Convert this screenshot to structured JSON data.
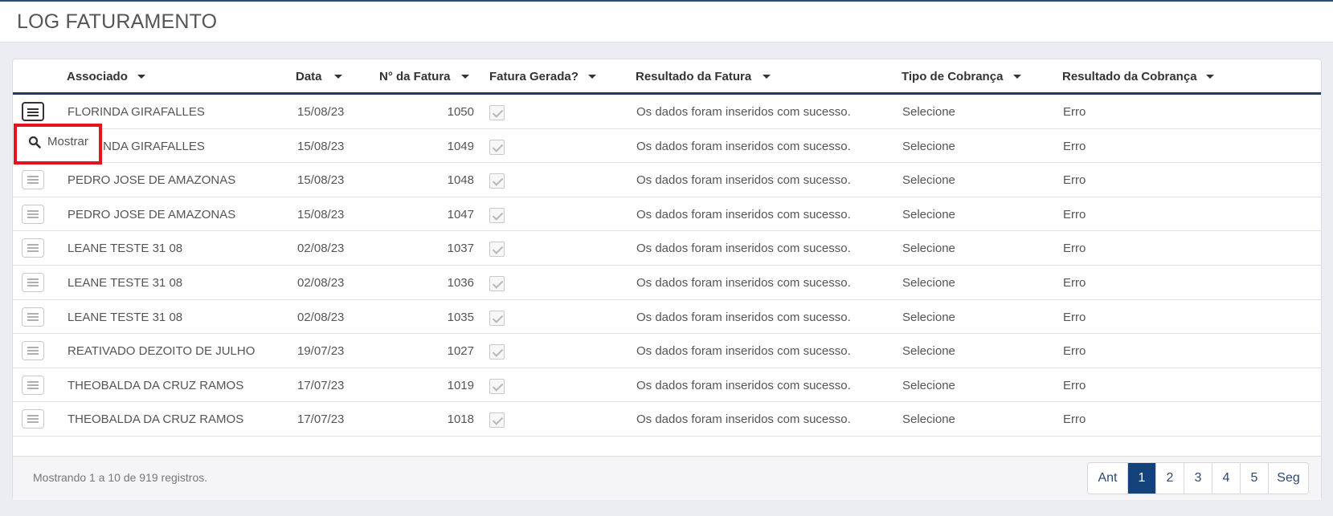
{
  "header": {
    "title": "LOG FATURAMENTO"
  },
  "table": {
    "columns": [
      "Associado",
      "Data",
      "N° da Fatura",
      "Fatura Gerada?",
      "Resultado da Fatura",
      "Tipo de Cobrança",
      "Resultado da Cobrança"
    ],
    "rows": [
      {
        "associado": "FLORINDA GIRAFALLES",
        "data": "15/08/23",
        "fatura": "1050",
        "resultado": "Os dados foram inseridos com sucesso.",
        "tipo": "Selecione",
        "resultado_cobranca": "Erro"
      },
      {
        "associado": "FLORINDA GIRAFALLES",
        "data": "15/08/23",
        "fatura": "1049",
        "resultado": "Os dados foram inseridos com sucesso.",
        "tipo": "Selecione",
        "resultado_cobranca": "Erro"
      },
      {
        "associado": "PEDRO JOSE DE AMAZONAS",
        "data": "15/08/23",
        "fatura": "1048",
        "resultado": "Os dados foram inseridos com sucesso.",
        "tipo": "Selecione",
        "resultado_cobranca": "Erro"
      },
      {
        "associado": "PEDRO JOSE DE AMAZONAS",
        "data": "15/08/23",
        "fatura": "1047",
        "resultado": "Os dados foram inseridos com sucesso.",
        "tipo": "Selecione",
        "resultado_cobranca": "Erro"
      },
      {
        "associado": "LEANE TESTE 31 08",
        "data": "02/08/23",
        "fatura": "1037",
        "resultado": "Os dados foram inseridos com sucesso.",
        "tipo": "Selecione",
        "resultado_cobranca": "Erro"
      },
      {
        "associado": "LEANE TESTE 31 08",
        "data": "02/08/23",
        "fatura": "1036",
        "resultado": "Os dados foram inseridos com sucesso.",
        "tipo": "Selecione",
        "resultado_cobranca": "Erro"
      },
      {
        "associado": "LEANE TESTE 31 08",
        "data": "02/08/23",
        "fatura": "1035",
        "resultado": "Os dados foram inseridos com sucesso.",
        "tipo": "Selecione",
        "resultado_cobranca": "Erro"
      },
      {
        "associado": "REATIVADO DEZOITO DE JULHO",
        "data": "19/07/23",
        "fatura": "1027",
        "resultado": "Os dados foram inseridos com sucesso.",
        "tipo": "Selecione",
        "resultado_cobranca": "Erro"
      },
      {
        "associado": "THEOBALDA DA CRUZ RAMOS",
        "data": "17/07/23",
        "fatura": "1019",
        "resultado": "Os dados foram inseridos com sucesso.",
        "tipo": "Selecione",
        "resultado_cobranca": "Erro"
      },
      {
        "associado": "THEOBALDA DA CRUZ RAMOS",
        "data": "17/07/23",
        "fatura": "1018",
        "resultado": "Os dados foram inseridos com sucesso.",
        "tipo": "Selecione",
        "resultado_cobranca": "Erro"
      }
    ]
  },
  "footer": {
    "info": "Mostrando 1 a 10 de 919 registros.",
    "pagination": [
      "Ant",
      "1",
      "2",
      "3",
      "4",
      "5",
      "Seg"
    ],
    "active_page": "1"
  },
  "popup": {
    "label": "Mostrar",
    "icon": "search-icon"
  },
  "colors": {
    "accent": "#14427a",
    "highlight": "#e4141b",
    "header_rule": "#1d3c63"
  }
}
